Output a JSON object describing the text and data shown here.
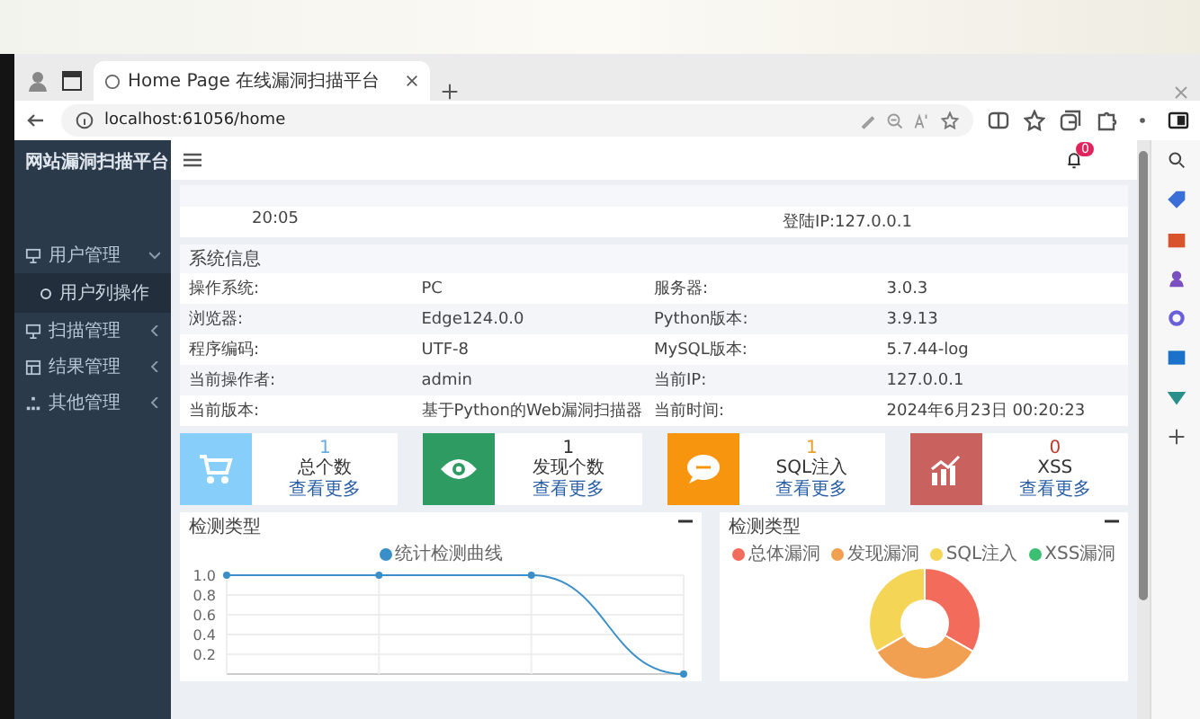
{
  "browser": {
    "tab_title": "Home Page 在线漏洞扫描平台",
    "url": "localhost:61056/home"
  },
  "sidebar": {
    "title": "网站漏洞扫描平台",
    "items": [
      {
        "label": "用户管理",
        "expanded": true,
        "children": [
          {
            "label": "用户列操作"
          }
        ]
      },
      {
        "label": "扫描管理",
        "expanded": false
      },
      {
        "label": "结果管理",
        "expanded": false
      },
      {
        "label": "其他管理",
        "expanded": false
      }
    ]
  },
  "header": {
    "notifications": "0"
  },
  "login_panel": {
    "time": "20:05",
    "ip": "登陆IP:127.0.0.1"
  },
  "system_info": {
    "title": "系统信息",
    "rows": [
      [
        "操作系统:",
        "PC",
        "服务器:",
        "3.0.3"
      ],
      [
        "浏览器:",
        "Edge124.0.0",
        "Python版本:",
        "3.9.13"
      ],
      [
        "程序编码:",
        "UTF-8",
        "MySQL版本:",
        "5.7.44-log"
      ],
      [
        "当前操作者:",
        "admin",
        "当前IP:",
        "127.0.0.1"
      ],
      [
        "当前版本:",
        "基于Python的Web漏洞扫描器",
        "当前时间:",
        "2024年6月23日 00:20:23"
      ]
    ]
  },
  "stats": [
    {
      "kind": "cart",
      "color": "#87cefa",
      "value": "1",
      "label": "总个数",
      "link": "查看更多"
    },
    {
      "kind": "eye",
      "color": "#2e9b63",
      "value": "1",
      "label": "发现个数",
      "link": "查看更多"
    },
    {
      "kind": "chat",
      "color": "#f7960e",
      "value": "1",
      "label": "SQL注入",
      "link": "查看更多"
    },
    {
      "kind": "trend",
      "color": "#c9615e",
      "value": "0",
      "label": "XSS",
      "link": "查看更多"
    }
  ],
  "charts": [
    {
      "title": "检测类型",
      "chart_data": {
        "type": "line",
        "legend": "top",
        "grid": true,
        "series": [
          {
            "name": "统计检测曲线",
            "color": "#3a8fc8",
            "marker": true,
            "values": [
              1,
              1,
              1,
              0
            ]
          }
        ],
        "ylim": [
          0,
          1
        ],
        "yticks": [
          {
            "value": 0.2,
            "label": "0.2"
          },
          {
            "value": 0.4,
            "label": "0.4"
          },
          {
            "value": 0.6,
            "label": "0.6"
          },
          {
            "value": 0.8,
            "label": "0.8"
          },
          {
            "value": 1,
            "label": "1.0"
          }
        ]
      }
    },
    {
      "title": "检测类型",
      "chart_data": {
        "type": "donut",
        "legend": "top",
        "categories": [
          "总体漏洞",
          "发现漏洞",
          "SQL注入",
          "XSS漏洞"
        ],
        "values": [
          33.33,
          33.33,
          33.34,
          0
        ],
        "colors": [
          "#f26b5b",
          "#f0a050",
          "#f5d556",
          "#3cbf72"
        ]
      }
    }
  ]
}
